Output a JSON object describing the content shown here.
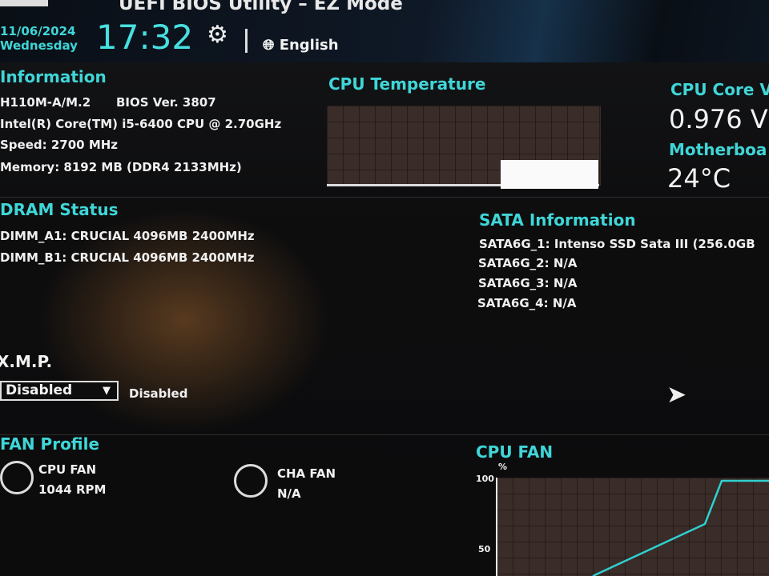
{
  "header": {
    "title": "UEFI BIOS Utility – EZ Mode",
    "date": "11/06/2024",
    "day": "Wednesday",
    "time": "17:32",
    "language": "English"
  },
  "information": {
    "heading": "Information",
    "board": "H110M-A/M.2",
    "bios": "BIOS Ver. 3807",
    "cpu": "Intel(R) Core(TM) i5-6400 CPU @ 2.70GHz",
    "speed": "Speed: 2700 MHz",
    "memory": "Memory: 8192 MB (DDR4 2133MHz)"
  },
  "cpu_temperature": {
    "heading": "CPU Temperature"
  },
  "voltage": {
    "heading": "CPU Core V",
    "value": "0.976 V",
    "mb_heading": "Motherboa",
    "mb_value": "24°C"
  },
  "dram": {
    "heading": "DRAM Status",
    "slots": [
      "DIMM_A1: CRUCIAL 4096MB 2400MHz",
      "DIMM_B1: CRUCIAL 4096MB 2400MHz"
    ]
  },
  "sata": {
    "heading": "SATA Information",
    "ports": [
      "SATA6G_1: Intenso SSD Sata III (256.0GB",
      "SATA6G_2: N/A",
      "SATA6G_3: N/A",
      "SATA6G_4: N/A"
    ]
  },
  "xmp": {
    "heading": "X.M.P.",
    "selected": "Disabled",
    "status": "Disabled"
  },
  "fan_profile": {
    "heading": "FAN Profile",
    "fans": [
      {
        "name": "CPU FAN",
        "value": "1044 RPM"
      },
      {
        "name": "CHA FAN",
        "value": "N/A"
      }
    ]
  },
  "cpu_fan_chart": {
    "heading": "CPU FAN",
    "unit": "%",
    "ticks": [
      "100",
      "50"
    ],
    "line_color": "#2fd0d0"
  }
}
